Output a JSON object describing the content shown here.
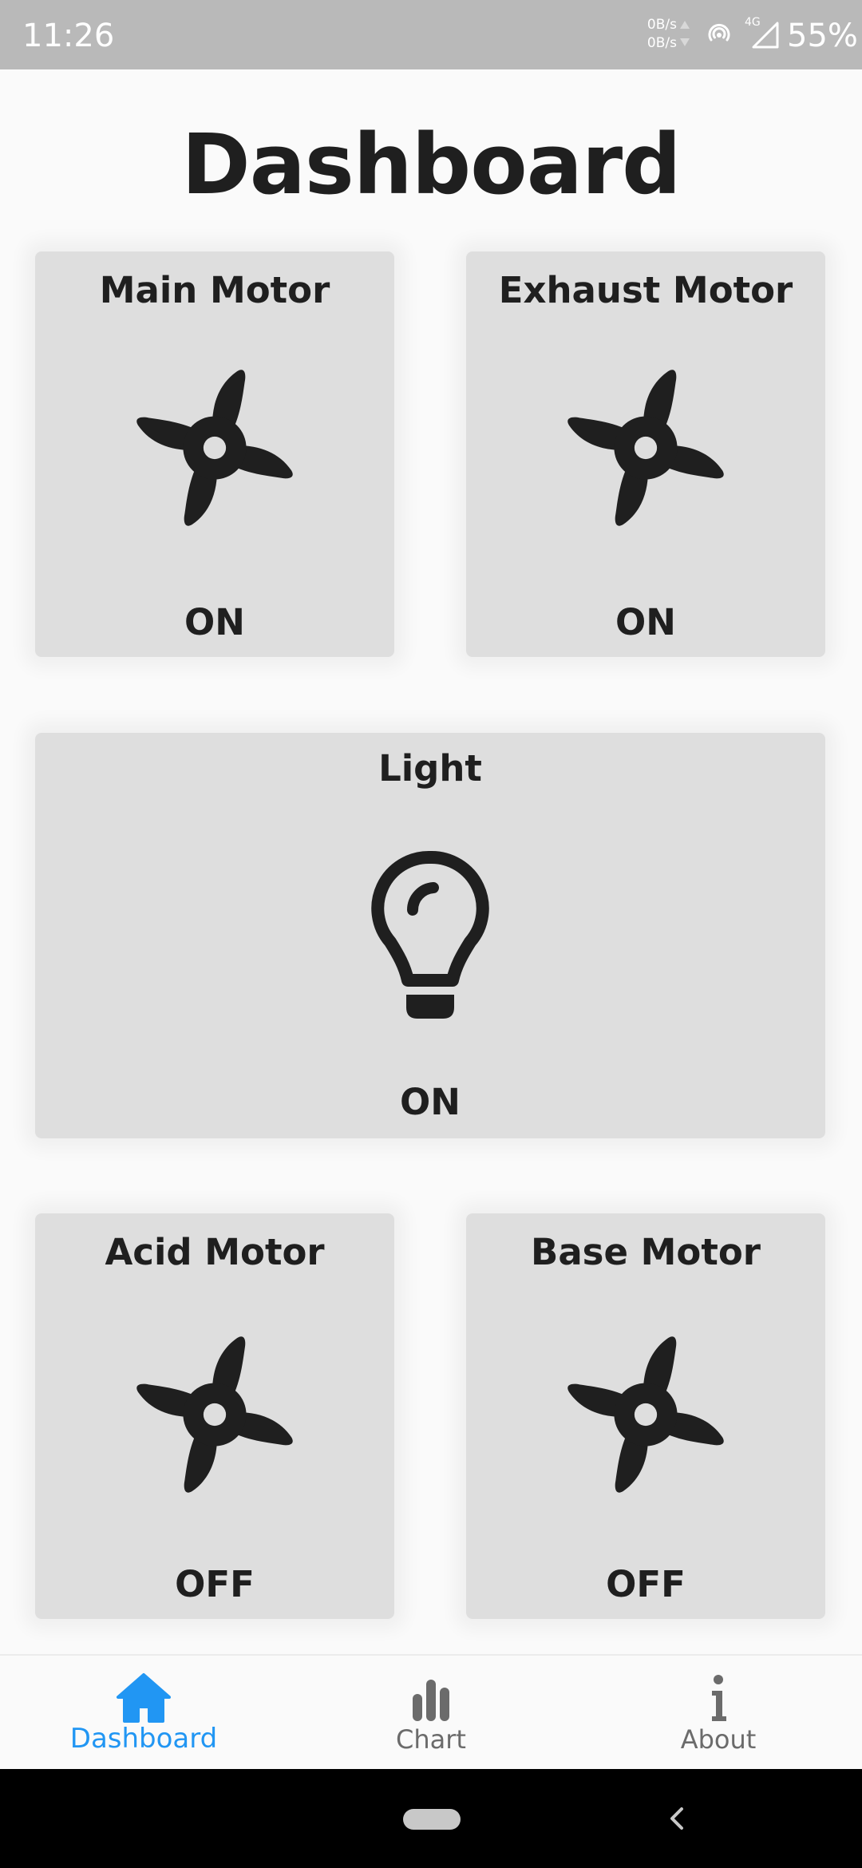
{
  "status_bar": {
    "time": "11:26",
    "net_up": "0B/s",
    "net_down": "0B/s",
    "network_type": "4G",
    "battery": "55%",
    "icons": [
      "net-arrows-icon",
      "hotspot-icon",
      "signal-icon"
    ]
  },
  "page": {
    "title": "Dashboard"
  },
  "cards": {
    "main_motor": {
      "title": "Main Motor",
      "state": "ON",
      "icon": "fan-icon"
    },
    "exhaust_motor": {
      "title": "Exhaust Motor",
      "state": "ON",
      "icon": "fan-icon"
    },
    "light": {
      "title": "Light",
      "state": "ON",
      "icon": "lightbulb-icon"
    },
    "acid_motor": {
      "title": "Acid Motor",
      "state": "OFF",
      "icon": "fan-icon"
    },
    "base_motor": {
      "title": "Base Motor",
      "state": "OFF",
      "icon": "fan-icon"
    }
  },
  "bottom_nav": {
    "items": [
      {
        "label": "Dashboard",
        "icon": "home-icon",
        "active": true
      },
      {
        "label": "Chart",
        "icon": "bar-chart-icon",
        "active": false
      },
      {
        "label": "About",
        "icon": "info-icon",
        "active": false
      }
    ],
    "active_color": "#2196f3",
    "inactive_color": "#6b6b6b"
  },
  "colors": {
    "card_bg": "#dedede",
    "page_bg": "#fafafa",
    "status_bar_bg": "#b9b9b9"
  }
}
